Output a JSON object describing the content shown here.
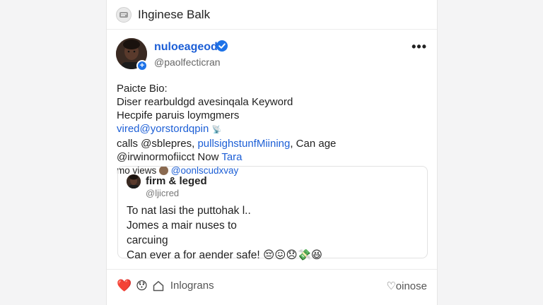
{
  "app": {
    "title": "Ihginese Balk"
  },
  "profile": {
    "display_name": "nuloeageod",
    "handle": "@paolfecticran",
    "more_label": "•••"
  },
  "bio": {
    "title": "Paicte Bio:",
    "line1": "Diser rearbuldgd avesinqala Keyword",
    "line2": "Hecpife paruis loymgmers",
    "line3_link": "vired@yorstordqpin",
    "line3_icon": "📡",
    "line4_text": "calls @sblepres, ",
    "line4_link": "pullsighstunfMiining",
    "line4_tail": ", Can age",
    "line5_text": "@irwinormofiicct Now ",
    "line5_link": "Tara",
    "line6_text": "mo views ",
    "line6_link": "@oonlscudxvay"
  },
  "quote": {
    "name": "firm & leged",
    "handle": "@ljicred",
    "line1": "To nat lasi the puttohak l..",
    "line2": "Jomes a mair nuses to",
    "line3": "carcuing",
    "line4": "Can ever a for aender safe! 😔😖😞💸😆"
  },
  "actions": {
    "heart": "❤️",
    "react": "😯",
    "home_label": "Inlograns",
    "share_label": "♡oinose"
  },
  "colors": {
    "accent": "#1d5fd6",
    "verified": "#1d72e8"
  }
}
